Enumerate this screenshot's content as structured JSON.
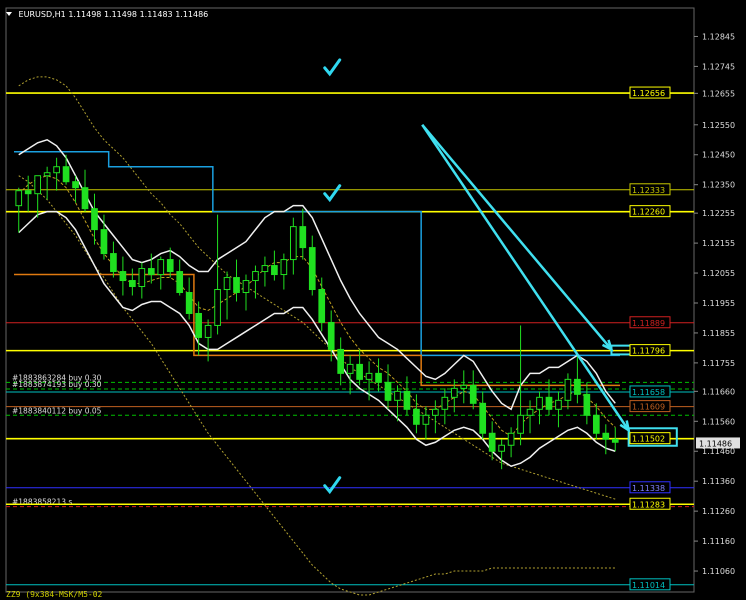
{
  "header": {
    "symbol": "EURUSD,H1",
    "ohlc": "1.11498 1.11498 1.11483 1.11486"
  },
  "footer": {
    "note": "ZZ9 (9x384-MSK/M5-02"
  },
  "chart_data": {
    "type": "candlestick",
    "symbol": "EURUSD",
    "timeframe": "H1",
    "ylim": [
      1.1099,
      1.1294
    ],
    "y_ticks": [
      1.12845,
      1.12745,
      1.12655,
      1.1255,
      1.1245,
      1.1235,
      1.12255,
      1.12155,
      1.12055,
      1.11955,
      1.11855,
      1.11755,
      1.1166,
      1.1156,
      1.1146,
      1.1136,
      1.1126,
      1.1116,
      1.1106
    ],
    "y_tick_labels": [
      "1.12845",
      "1.12745",
      "1.12655",
      "1.12550",
      "1.12450",
      "1.12350",
      "1.12255",
      "1.12155",
      "1.12055",
      "1.11955",
      "1.11855",
      "1.11755",
      "1.11660",
      "1.11560",
      "1.11460",
      "1.11360",
      "1.11260",
      "1.11160",
      "1.11060"
    ],
    "current_price": 1.11486,
    "current_price_label": "1.11486",
    "price_levels": [
      {
        "value": 1.12656,
        "label": "1.12656",
        "color": "#ffff00",
        "style": "solid",
        "badge": true
      },
      {
        "value": 1.12333,
        "label": "1.12333",
        "color": "#c8c800",
        "style": "solid-thin",
        "badge": true
      },
      {
        "value": 1.1226,
        "label": "1.12260",
        "color": "#ffff00",
        "style": "solid",
        "badge": true
      },
      {
        "value": 1.11889,
        "label": "1.11889",
        "color": "#d02020",
        "style": "solid-thin",
        "badge": true
      },
      {
        "value": 1.11796,
        "label": "1.11796",
        "color": "#ffff00",
        "style": "solid",
        "badge": true
      },
      {
        "value": 1.11658,
        "label": "1.11658",
        "color": "#00c0c0",
        "style": "solid-thin",
        "badge": true
      },
      {
        "value": 1.11609,
        "label": "1.11609",
        "color": "#c06020",
        "style": "solid-thin",
        "badge": true
      },
      {
        "value": 1.11502,
        "label": "1.11502",
        "color": "#ffff00",
        "style": "solid",
        "badge": true
      },
      {
        "value": 1.11338,
        "label": "1.11338",
        "color": "#3030ff",
        "style": "solid-thin",
        "badge": true
      },
      {
        "value": 1.11283,
        "label": "1.11283",
        "color": "#ffff00",
        "style": "solid",
        "badge": true
      },
      {
        "value": 1.11014,
        "label": "1.11014",
        "color": "#00c0c0",
        "style": "solid-thin",
        "badge": true
      }
    ],
    "order_lines": [
      {
        "label": "#1883863284 buy 0.30",
        "value": 1.1169,
        "color": "#00c000"
      },
      {
        "label": "#1883874193 buy 0.30",
        "value": 1.11668,
        "color": "#00c000"
      },
      {
        "label": "#1883840112 buy 0.05",
        "value": 1.1158,
        "color": "#00c000"
      },
      {
        "label": "#1883858213 s",
        "value": 1.11275,
        "color": "#d02020"
      }
    ],
    "annotations": {
      "checkmarks": [
        {
          "x_idx": 0.472,
          "value": 1.1274
        },
        {
          "x_idx": 0.472,
          "value": 1.1232
        },
        {
          "x_idx": 0.472,
          "value": 1.11345
        }
      ],
      "arrows": [
        {
          "from": [
            0.605,
            1.1255
          ],
          "to": [
            0.88,
            1.118
          ]
        },
        {
          "from": [
            0.605,
            1.1255
          ],
          "to": [
            0.905,
            1.1153
          ]
        }
      ],
      "boxes": [
        {
          "x_idx": [
            0.88,
            0.955
          ],
          "value": [
            1.1179,
            1.11806
          ]
        },
        {
          "x_idx": [
            0.905,
            0.975
          ],
          "value": [
            1.11485,
            1.1153
          ]
        }
      ]
    },
    "candles": [
      [
        1.1228,
        1.1234,
        1.1219,
        1.1233
      ],
      [
        1.1233,
        1.1238,
        1.1226,
        1.1232
      ],
      [
        1.1232,
        1.1236,
        1.1224,
        1.1238
      ],
      [
        1.1238,
        1.1241,
        1.123,
        1.1239
      ],
      [
        1.1239,
        1.1244,
        1.1233,
        1.1241
      ],
      [
        1.1241,
        1.1245,
        1.1235,
        1.1236
      ],
      [
        1.1236,
        1.1238,
        1.1229,
        1.1234
      ],
      [
        1.1234,
        1.124,
        1.1226,
        1.1227
      ],
      [
        1.1227,
        1.1232,
        1.1215,
        1.122
      ],
      [
        1.122,
        1.1225,
        1.121,
        1.1212
      ],
      [
        1.1212,
        1.1216,
        1.1204,
        1.1206
      ],
      [
        1.1206,
        1.1211,
        1.1198,
        1.1203
      ],
      [
        1.1203,
        1.1207,
        1.1198,
        1.1201
      ],
      [
        1.1201,
        1.1209,
        1.1197,
        1.1207
      ],
      [
        1.1207,
        1.1212,
        1.1202,
        1.1205
      ],
      [
        1.1205,
        1.1211,
        1.12,
        1.121
      ],
      [
        1.121,
        1.1214,
        1.1204,
        1.1206
      ],
      [
        1.1206,
        1.121,
        1.1198,
        1.1199
      ],
      [
        1.1199,
        1.1204,
        1.119,
        1.1192
      ],
      [
        1.1192,
        1.1196,
        1.1178,
        1.1184
      ],
      [
        1.1184,
        1.119,
        1.1176,
        1.1188
      ],
      [
        1.1188,
        1.1225,
        1.1185,
        1.12
      ],
      [
        1.12,
        1.1206,
        1.119,
        1.1204
      ],
      [
        1.1204,
        1.121,
        1.1196,
        1.1199
      ],
      [
        1.1199,
        1.1205,
        1.1193,
        1.1203
      ],
      [
        1.1203,
        1.1208,
        1.1197,
        1.1206
      ],
      [
        1.1206,
        1.1211,
        1.1201,
        1.1208
      ],
      [
        1.1208,
        1.1213,
        1.1203,
        1.1205
      ],
      [
        1.1205,
        1.1212,
        1.12,
        1.121
      ],
      [
        1.121,
        1.1224,
        1.1205,
        1.1221
      ],
      [
        1.1221,
        1.1227,
        1.121,
        1.1214
      ],
      [
        1.1214,
        1.1218,
        1.1198,
        1.12
      ],
      [
        1.12,
        1.1204,
        1.1186,
        1.1189
      ],
      [
        1.1189,
        1.1193,
        1.1176,
        1.118
      ],
      [
        1.118,
        1.1184,
        1.1168,
        1.1172
      ],
      [
        1.1172,
        1.1178,
        1.1165,
        1.1175
      ],
      [
        1.1175,
        1.118,
        1.1168,
        1.117
      ],
      [
        1.117,
        1.1176,
        1.1163,
        1.1172
      ],
      [
        1.1172,
        1.1177,
        1.1166,
        1.1169
      ],
      [
        1.1169,
        1.1175,
        1.116,
        1.1163
      ],
      [
        1.1163,
        1.1168,
        1.1156,
        1.1166
      ],
      [
        1.1166,
        1.1171,
        1.1158,
        1.116
      ],
      [
        1.116,
        1.1165,
        1.1152,
        1.1155
      ],
      [
        1.1155,
        1.1161,
        1.115,
        1.1158
      ],
      [
        1.1158,
        1.1163,
        1.1152,
        1.116
      ],
      [
        1.116,
        1.1167,
        1.1155,
        1.1164
      ],
      [
        1.1164,
        1.117,
        1.1159,
        1.1167
      ],
      [
        1.1167,
        1.1173,
        1.1162,
        1.1168
      ],
      [
        1.1168,
        1.1173,
        1.116,
        1.1162
      ],
      [
        1.1162,
        1.1166,
        1.115,
        1.1152
      ],
      [
        1.1152,
        1.1156,
        1.1143,
        1.1146
      ],
      [
        1.1146,
        1.115,
        1.114,
        1.1148
      ],
      [
        1.1148,
        1.1154,
        1.1144,
        1.1152
      ],
      [
        1.1152,
        1.1188,
        1.1148,
        1.1158
      ],
      [
        1.1158,
        1.1163,
        1.1152,
        1.116
      ],
      [
        1.116,
        1.1166,
        1.1155,
        1.1164
      ],
      [
        1.1164,
        1.117,
        1.1158,
        1.116
      ],
      [
        1.116,
        1.1166,
        1.1154,
        1.1163
      ],
      [
        1.1163,
        1.1172,
        1.116,
        1.117
      ],
      [
        1.117,
        1.1178,
        1.1162,
        1.1165
      ],
      [
        1.1165,
        1.1169,
        1.1155,
        1.1158
      ],
      [
        1.1158,
        1.1162,
        1.115,
        1.1152
      ],
      [
        1.1152,
        1.1155,
        1.1145,
        1.115
      ],
      [
        1.115,
        1.1154,
        1.1146,
        1.1149
      ]
    ],
    "bands": {
      "upper": [
        1.1245,
        1.1247,
        1.1249,
        1.125,
        1.1248,
        1.1244,
        1.1238,
        1.1232,
        1.1226,
        1.1222,
        1.1218,
        1.1214,
        1.121,
        1.1209,
        1.121,
        1.1212,
        1.1213,
        1.1211,
        1.1208,
        1.1206,
        1.1206,
        1.121,
        1.1212,
        1.1214,
        1.1216,
        1.122,
        1.1224,
        1.1226,
        1.1226,
        1.1228,
        1.1228,
        1.1224,
        1.1217,
        1.121,
        1.1203,
        1.1197,
        1.1192,
        1.1188,
        1.1184,
        1.1182,
        1.118,
        1.1177,
        1.1174,
        1.1171,
        1.117,
        1.1172,
        1.1175,
        1.1178,
        1.1176,
        1.1171,
        1.1166,
        1.1162,
        1.116,
        1.1168,
        1.1172,
        1.1172,
        1.1174,
        1.1174,
        1.1176,
        1.1178,
        1.1176,
        1.1172,
        1.1166,
        1.1162
      ],
      "middle": [
        1.1232,
        1.1235,
        1.1237,
        1.1238,
        1.1237,
        1.1234,
        1.1229,
        1.1223,
        1.1217,
        1.1212,
        1.1208,
        1.1204,
        1.1202,
        1.1202,
        1.1203,
        1.1204,
        1.1204,
        1.1202,
        1.1198,
        1.1194,
        1.1193,
        1.1195,
        1.1197,
        1.1199,
        1.1201,
        1.1204,
        1.1207,
        1.1209,
        1.1209,
        1.1211,
        1.1211,
        1.1207,
        1.1201,
        1.1195,
        1.1189,
        1.1184,
        1.118,
        1.1177,
        1.1174,
        1.1172,
        1.1169,
        1.1166,
        1.1162,
        1.116,
        1.116,
        1.1162,
        1.1164,
        1.1166,
        1.1165,
        1.1161,
        1.1157,
        1.1153,
        1.1151,
        1.1155,
        1.1158,
        1.116,
        1.1162,
        1.1163,
        1.1165,
        1.1166,
        1.1164,
        1.1161,
        1.1157,
        1.1154
      ],
      "lower": [
        1.1219,
        1.1222,
        1.1225,
        1.1226,
        1.1226,
        1.1224,
        1.122,
        1.1214,
        1.1208,
        1.1202,
        1.1198,
        1.1194,
        1.1193,
        1.1195,
        1.1196,
        1.1196,
        1.1194,
        1.1192,
        1.1188,
        1.1182,
        1.118,
        1.118,
        1.1182,
        1.1184,
        1.1186,
        1.1188,
        1.119,
        1.1192,
        1.1192,
        1.1194,
        1.1194,
        1.119,
        1.1185,
        1.118,
        1.1175,
        1.117,
        1.1167,
        1.1165,
        1.1163,
        1.116,
        1.1157,
        1.1154,
        1.115,
        1.1148,
        1.1149,
        1.1151,
        1.1153,
        1.1154,
        1.1153,
        1.115,
        1.1146,
        1.1143,
        1.1141,
        1.1142,
        1.1144,
        1.1147,
        1.1149,
        1.1151,
        1.1153,
        1.1154,
        1.1152,
        1.1149,
        1.1147,
        1.1146
      ]
    },
    "envelope_upper": [
      1.1268,
      1.127,
      1.1271,
      1.1271,
      1.127,
      1.1268,
      1.1264,
      1.1259,
      1.1254,
      1.125,
      1.1247,
      1.1244,
      1.124,
      1.1236,
      1.1232,
      1.1229,
      1.1225,
      1.1222,
      1.1218,
      1.1214,
      1.1211,
      1.1208,
      1.1205,
      1.1203,
      1.1201,
      1.1199,
      1.1197,
      1.1195,
      1.1193,
      1.1191,
      1.1189,
      1.1186,
      1.1183,
      1.118,
      1.1177,
      1.1174,
      1.1172,
      1.117,
      1.1168,
      1.1166,
      1.1164,
      1.1162,
      1.116,
      1.1158,
      1.1156,
      1.1154,
      1.1152,
      1.115,
      1.1148,
      1.1146,
      1.1144,
      1.1142,
      1.1141,
      1.114,
      1.1139,
      1.1138,
      1.1137,
      1.1136,
      1.1135,
      1.1134,
      1.1133,
      1.1132,
      1.1131,
      1.113
    ],
    "envelope_lower": [
      1.1238,
      1.1236,
      1.1233,
      1.123,
      1.1226,
      1.1222,
      1.1218,
      1.1213,
      1.1208,
      1.1204,
      1.1199,
      1.1194,
      1.119,
      1.1186,
      1.1182,
      1.1177,
      1.1172,
      1.1167,
      1.1162,
      1.1157,
      1.1152,
      1.1148,
      1.1144,
      1.114,
      1.1136,
      1.1132,
      1.1128,
      1.1124,
      1.112,
      1.1116,
      1.1112,
      1.1108,
      1.1105,
      1.1102,
      1.11,
      1.1099,
      1.1098,
      1.1098,
      1.1099,
      1.11,
      1.1101,
      1.1102,
      1.1103,
      1.1104,
      1.1105,
      1.1105,
      1.1106,
      1.1106,
      1.1106,
      1.1106,
      1.1107,
      1.1107,
      1.1107,
      1.1107,
      1.1107,
      1.1107,
      1.1107,
      1.1107,
      1.1107,
      1.1107,
      1.1107,
      1.1107,
      1.1107,
      1.1107
    ],
    "stair_upper": [
      1.1246,
      1.1246,
      1.1246,
      1.1246,
      1.1246,
      1.1246,
      1.1246,
      1.1246,
      1.1246,
      1.1246,
      1.1241,
      1.1241,
      1.1241,
      1.1241,
      1.1241,
      1.1241,
      1.1241,
      1.1241,
      1.1241,
      1.1241,
      1.1241,
      1.1226,
      1.1226,
      1.1226,
      1.1226,
      1.1226,
      1.1226,
      1.1226,
      1.1226,
      1.1226,
      1.1226,
      1.1226,
      1.1226,
      1.1226,
      1.1226,
      1.1226,
      1.1226,
      1.1226,
      1.1226,
      1.1226,
      1.1226,
      1.1226,
      1.1226,
      1.1178,
      1.1178,
      1.1178,
      1.1178,
      1.1178,
      1.1178,
      1.1178,
      1.1178,
      1.1178,
      1.1178,
      1.1178,
      1.1178,
      1.1178,
      1.1178,
      1.1178,
      1.1178,
      1.1178,
      1.1178,
      1.1178,
      1.1178,
      1.1178
    ],
    "stair_lower": [
      1.1205,
      1.1205,
      1.1205,
      1.1205,
      1.1205,
      1.1205,
      1.1205,
      1.1205,
      1.1205,
      1.1205,
      1.1205,
      1.1205,
      1.1205,
      1.1205,
      1.1205,
      1.1205,
      1.1205,
      1.1205,
      1.1205,
      1.1178,
      1.1178,
      1.1178,
      1.1178,
      1.1178,
      1.1178,
      1.1178,
      1.1178,
      1.1178,
      1.1178,
      1.1178,
      1.1178,
      1.1178,
      1.1178,
      1.1178,
      1.1178,
      1.1178,
      1.1178,
      1.1178,
      1.1178,
      1.1178,
      1.1178,
      1.1178,
      1.1178,
      1.1168,
      1.1168,
      1.1168,
      1.1168,
      1.1168,
      1.1168,
      1.1168,
      1.1168,
      1.1168,
      1.1168,
      1.1168,
      1.1168,
      1.1168,
      1.1168,
      1.1168,
      1.1168,
      1.1168,
      1.1168,
      1.1168,
      1.1168,
      1.1168
    ]
  }
}
